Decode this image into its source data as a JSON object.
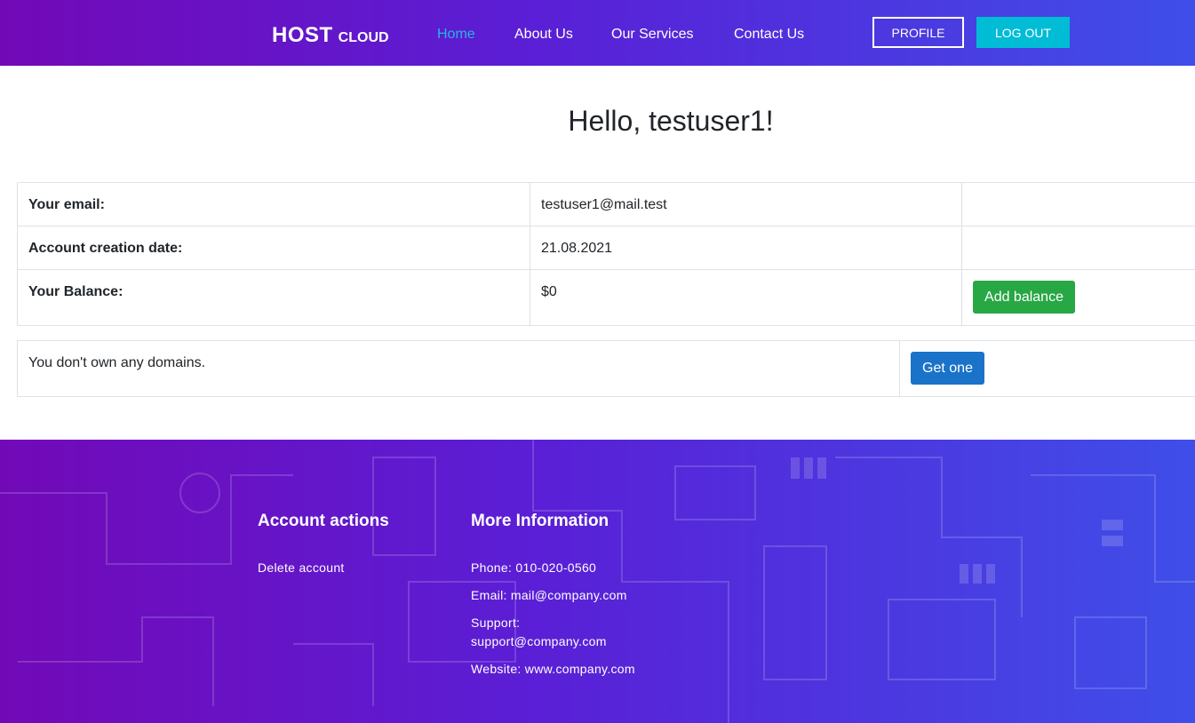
{
  "nav": {
    "brand_main": "HOST",
    "brand_sub": "CLOUD",
    "links": [
      "Home",
      "About Us",
      "Our Services",
      "Contact Us"
    ],
    "profile_label": "PROFILE",
    "logout_label": "LOG OUT",
    "active_color": "#22b8e0"
  },
  "main": {
    "greeting": "Hello, testuser1!",
    "info_rows": [
      {
        "label": "Your email:",
        "value": "testuser1@mail.test"
      },
      {
        "label": "Account creation date:",
        "value": "21.08.2021"
      },
      {
        "label": "Your Balance:",
        "value": "$0"
      }
    ],
    "add_balance_label": "Add balance",
    "domains_message": "You don't own any domains.",
    "get_one_label": "Get one"
  },
  "footer": {
    "account_heading": "Account actions",
    "delete_account": "Delete account",
    "info_heading": "More Information",
    "phone": "Phone: 010-020-0560",
    "email": "Email: mail@company.com",
    "support_label": "Support:",
    "support_email": "support@company.com",
    "website": "Website: www.company.com"
  },
  "colors": {
    "gradient_start": "#7209b7",
    "gradient_end": "#3f4ee8",
    "logout_bg": "#00bcd4",
    "add_balance_bg": "#28a745",
    "get_one_bg": "#1a73c9"
  }
}
